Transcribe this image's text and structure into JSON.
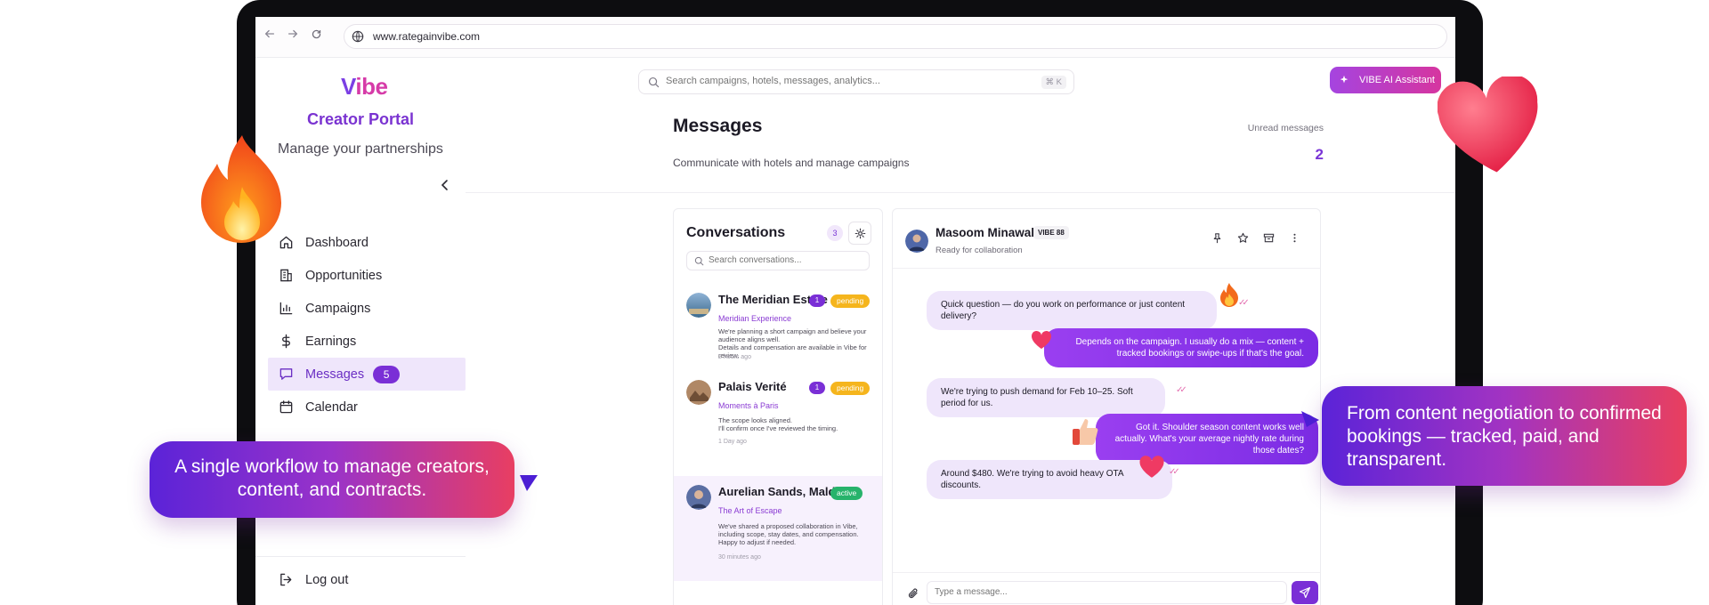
{
  "browser": {
    "url": "www.rategainvibe.com",
    "back_icon": "arrow-left-icon",
    "forward_icon": "arrow-right-icon",
    "reload_icon": "reload-icon"
  },
  "sidebar": {
    "logo_v": "V",
    "logo_rest": "ibe",
    "portal_title": "Creator Portal",
    "tagline": "Manage your partnerships",
    "items": [
      {
        "label": "Dashboard",
        "icon": "home-icon"
      },
      {
        "label": "Opportunities",
        "icon": "building-icon"
      },
      {
        "label": "Campaigns",
        "icon": "bar-chart-icon"
      },
      {
        "label": "Earnings",
        "icon": "dollar-icon"
      },
      {
        "label": "Messages",
        "icon": "message-icon",
        "badge": "5",
        "active": true
      },
      {
        "label": "Calendar",
        "icon": "calendar-icon"
      }
    ],
    "logout_label": "Log out"
  },
  "header": {
    "search_placeholder": "Search campaigns, hotels, messages, analytics...",
    "shortcut": "⌘ K",
    "ai_button": "VIBE AI Assistant"
  },
  "page": {
    "title": "Messages",
    "subtitle": "Communicate with hotels and manage campaigns",
    "unread_label": "Unread messages",
    "unread_count": "2"
  },
  "conversations": {
    "title": "Conversations",
    "count": "3",
    "search_placeholder": "Search conversations...",
    "items": [
      {
        "name": "The Meridian Estate",
        "unread": "1",
        "status": "pending",
        "subtitle": "Meridian Experience",
        "preview": "We're planning a short campaign and believe your audience aligns well.\nDetails and compensation are available in Vibe for review.",
        "time": "2 hours ago"
      },
      {
        "name": "Palais Verité",
        "unread": "1",
        "status": "pending",
        "subtitle": "Moments à Paris",
        "preview": "The scope looks aligned.\nI'll confirm once I've reviewed the timing.",
        "time": "1 Day ago"
      },
      {
        "name": "Aurelian Sands, Maldives",
        "status": "active",
        "subtitle": "The Art of Escape",
        "preview": "We've shared a proposed collaboration in Vibe, including scope, stay dates, and compensation.\nHappy to adjust if needed.",
        "time": "30 minutes ago"
      }
    ]
  },
  "chat": {
    "contact_name": "Masoom Minawala",
    "contact_tag": "VIBE 88",
    "contact_status": "Ready for collaboration",
    "messages": [
      {
        "direction": "in",
        "text": "Quick question — do you work on performance or just content delivery?"
      },
      {
        "direction": "out",
        "text": "Depends on the campaign. I usually do a mix — content + tracked bookings or swipe-ups if that's the goal."
      },
      {
        "direction": "in",
        "text": "We're trying to push demand for Feb 10–25. Soft period for us."
      },
      {
        "direction": "out",
        "text": "Got it. Shoulder season content works well actually. What's your average nightly rate during those dates?"
      },
      {
        "direction": "in",
        "text": "Around $480. We're trying to avoid heavy OTA discounts."
      }
    ],
    "composer_placeholder": "Type a message..."
  },
  "callouts": {
    "left": "A single workflow to manage creators, content, and contracts.",
    "right": "From content negotiation to confirmed bookings — tracked, paid, and transparent."
  },
  "colors": {
    "brand_purple": "#7a2fd6",
    "brand_pink": "#d63ba8",
    "pending": "#f5b51d",
    "active": "#27b36b"
  }
}
